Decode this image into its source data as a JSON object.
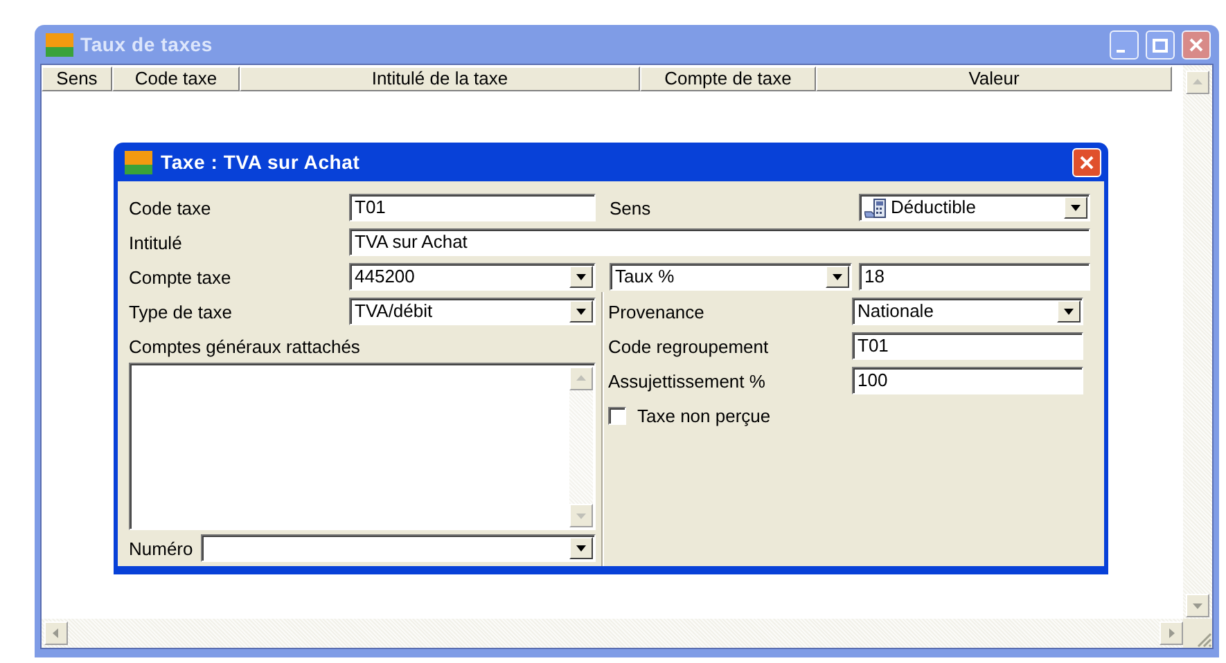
{
  "window": {
    "title": "Taux de taxes"
  },
  "table": {
    "columns": [
      "Sens",
      "Code taxe",
      "Intitulé de la taxe",
      "Compte de taxe",
      "Valeur"
    ]
  },
  "dialog": {
    "title": "Taxe : TVA sur Achat",
    "code_taxe": {
      "label": "Code taxe",
      "value": "T01"
    },
    "sens": {
      "label": "Sens",
      "value": "Déductible"
    },
    "intitule": {
      "label": "Intitulé",
      "value": "TVA sur Achat"
    },
    "compte_taxe": {
      "label": "Compte taxe",
      "value": "445200"
    },
    "taux": {
      "option": "Taux %",
      "value": "18"
    },
    "type_taxe": {
      "label": "Type de taxe",
      "value": "TVA/débit"
    },
    "comptes_generaux": {
      "label": "Comptes généraux rattachés"
    },
    "numero": {
      "label": "Numéro"
    },
    "provenance": {
      "label": "Provenance",
      "value": "Nationale"
    },
    "code_regroupement": {
      "label": "Code regroupement",
      "value": "T01"
    },
    "assujettissement": {
      "label": "Assujettissement %",
      "value": "100"
    },
    "taxe_non_percue": {
      "label": "Taxe non perçue",
      "checked": false
    }
  }
}
